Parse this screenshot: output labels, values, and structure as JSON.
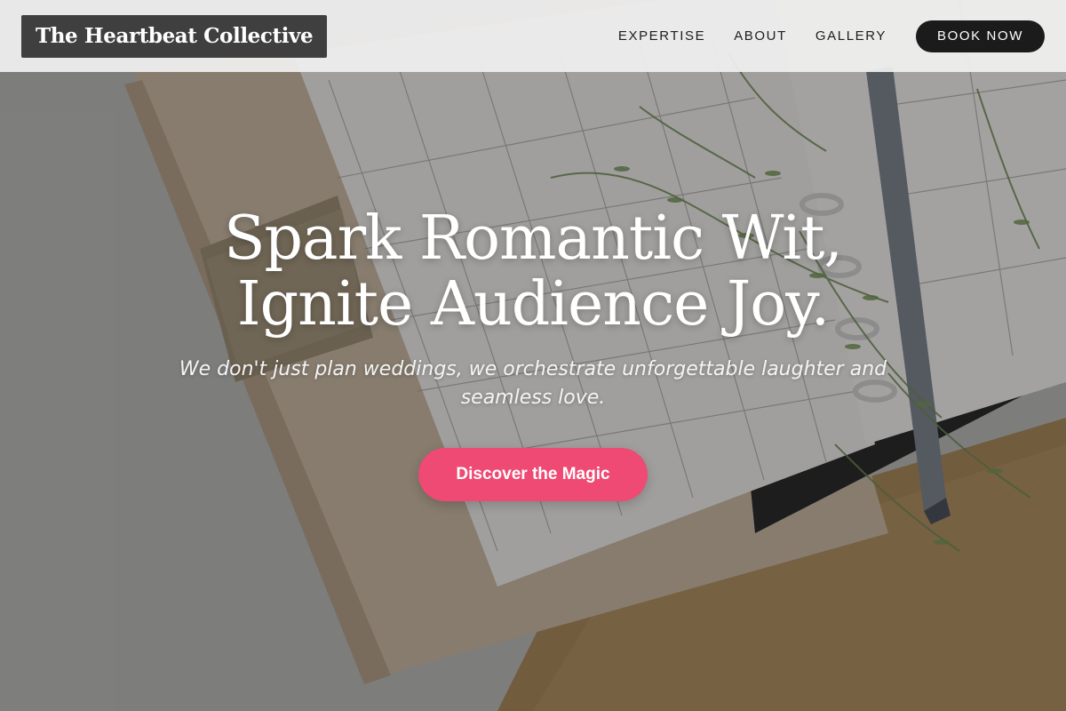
{
  "header": {
    "logo_text": "The Heartbeat Collective",
    "nav": [
      {
        "label": "EXPERTISE"
      },
      {
        "label": "ABOUT"
      },
      {
        "label": "GALLERY"
      }
    ],
    "book_label": "BOOK NOW"
  },
  "hero": {
    "title_line1": "Spark Romantic Wit,",
    "title_line2": "Ignite Audience Joy.",
    "subtitle": "We don't just plan weddings, we orchestrate unforgettable laughter and seamless love.",
    "cta_label": "Discover the Magic"
  },
  "colors": {
    "accent": "#ee4a73",
    "header_bg": "#f0f0f0",
    "logo_bg": "#3f3f3f",
    "book_button_bg": "#1b1b1b"
  },
  "icons": {
    "background_image": "planner-with-flowers-photo"
  }
}
